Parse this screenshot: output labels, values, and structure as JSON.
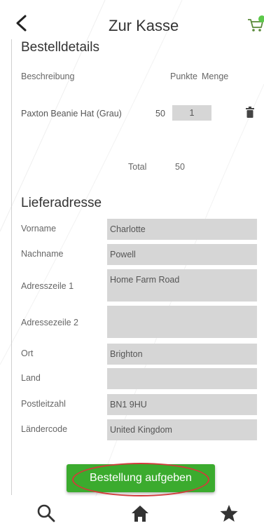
{
  "header": {
    "title": "Zur Kasse",
    "back_icon": "chevron-left-icon",
    "cart_icon": "shopping-cart-icon"
  },
  "order_details": {
    "heading": "Bestelldetails",
    "columns": {
      "description": "Beschreibung",
      "points": "Punkte",
      "quantity": "Menge"
    },
    "items": [
      {
        "description": "Paxton Beanie Hat (Grau)",
        "points": "50",
        "quantity": "1"
      }
    ],
    "total_label": "Total",
    "total_value": "50"
  },
  "delivery": {
    "heading": "Lieferadresse",
    "fields": {
      "first_name": {
        "label": "Vorname",
        "value": "Charlotte"
      },
      "last_name": {
        "label": "Nachname",
        "value": "Powell"
      },
      "address1": {
        "label": "Adresszeile 1",
        "value": "Home Farm Road"
      },
      "address2": {
        "label": "Adressezeile 2",
        "value": ""
      },
      "city": {
        "label": "Ort",
        "value": "Brighton"
      },
      "country": {
        "label": "Land",
        "value": ""
      },
      "postcode": {
        "label": "Postleitzahl",
        "value": "BN1 9HU"
      },
      "country_code": {
        "label": "Ländercode",
        "value": "United Kingdom"
      }
    }
  },
  "actions": {
    "place_order": "Bestellung aufgeben"
  },
  "bottom_nav": {
    "items": [
      {
        "icon": "search-icon"
      },
      {
        "icon": "home-icon"
      },
      {
        "icon": "star-icon"
      }
    ]
  },
  "colors": {
    "accent": "#3bab2e",
    "highlight": "#d23b3b",
    "field_bg": "#d6d6d6",
    "badge": "#5cc84a"
  }
}
